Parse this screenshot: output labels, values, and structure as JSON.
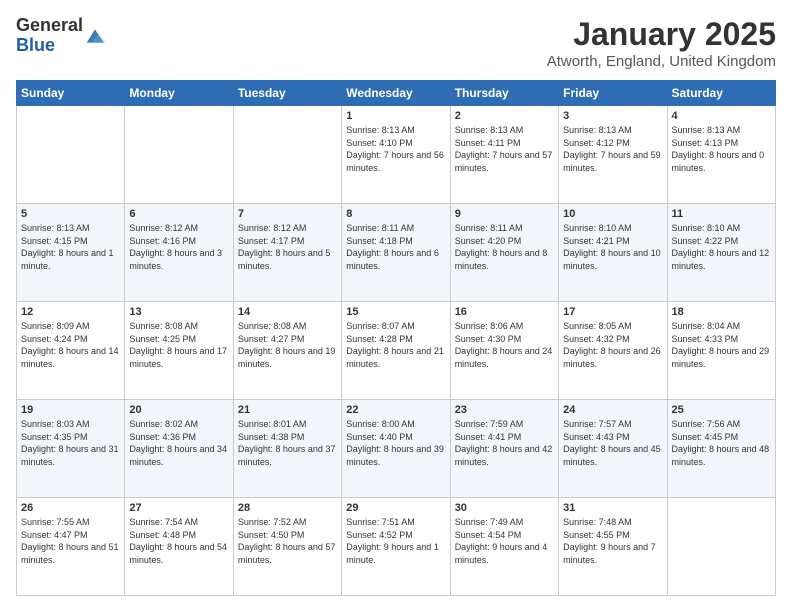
{
  "logo": {
    "general": "General",
    "blue": "Blue"
  },
  "header": {
    "title": "January 2025",
    "subtitle": "Atworth, England, United Kingdom"
  },
  "weekdays": [
    "Sunday",
    "Monday",
    "Tuesday",
    "Wednesday",
    "Thursday",
    "Friday",
    "Saturday"
  ],
  "weeks": [
    [
      {
        "day": "",
        "sunrise": "",
        "sunset": "",
        "daylight": ""
      },
      {
        "day": "",
        "sunrise": "",
        "sunset": "",
        "daylight": ""
      },
      {
        "day": "",
        "sunrise": "",
        "sunset": "",
        "daylight": ""
      },
      {
        "day": "1",
        "sunrise": "Sunrise: 8:13 AM",
        "sunset": "Sunset: 4:10 PM",
        "daylight": "Daylight: 7 hours and 56 minutes."
      },
      {
        "day": "2",
        "sunrise": "Sunrise: 8:13 AM",
        "sunset": "Sunset: 4:11 PM",
        "daylight": "Daylight: 7 hours and 57 minutes."
      },
      {
        "day": "3",
        "sunrise": "Sunrise: 8:13 AM",
        "sunset": "Sunset: 4:12 PM",
        "daylight": "Daylight: 7 hours and 59 minutes."
      },
      {
        "day": "4",
        "sunrise": "Sunrise: 8:13 AM",
        "sunset": "Sunset: 4:13 PM",
        "daylight": "Daylight: 8 hours and 0 minutes."
      }
    ],
    [
      {
        "day": "5",
        "sunrise": "Sunrise: 8:13 AM",
        "sunset": "Sunset: 4:15 PM",
        "daylight": "Daylight: 8 hours and 1 minute."
      },
      {
        "day": "6",
        "sunrise": "Sunrise: 8:12 AM",
        "sunset": "Sunset: 4:16 PM",
        "daylight": "Daylight: 8 hours and 3 minutes."
      },
      {
        "day": "7",
        "sunrise": "Sunrise: 8:12 AM",
        "sunset": "Sunset: 4:17 PM",
        "daylight": "Daylight: 8 hours and 5 minutes."
      },
      {
        "day": "8",
        "sunrise": "Sunrise: 8:11 AM",
        "sunset": "Sunset: 4:18 PM",
        "daylight": "Daylight: 8 hours and 6 minutes."
      },
      {
        "day": "9",
        "sunrise": "Sunrise: 8:11 AM",
        "sunset": "Sunset: 4:20 PM",
        "daylight": "Daylight: 8 hours and 8 minutes."
      },
      {
        "day": "10",
        "sunrise": "Sunrise: 8:10 AM",
        "sunset": "Sunset: 4:21 PM",
        "daylight": "Daylight: 8 hours and 10 minutes."
      },
      {
        "day": "11",
        "sunrise": "Sunrise: 8:10 AM",
        "sunset": "Sunset: 4:22 PM",
        "daylight": "Daylight: 8 hours and 12 minutes."
      }
    ],
    [
      {
        "day": "12",
        "sunrise": "Sunrise: 8:09 AM",
        "sunset": "Sunset: 4:24 PM",
        "daylight": "Daylight: 8 hours and 14 minutes."
      },
      {
        "day": "13",
        "sunrise": "Sunrise: 8:08 AM",
        "sunset": "Sunset: 4:25 PM",
        "daylight": "Daylight: 8 hours and 17 minutes."
      },
      {
        "day": "14",
        "sunrise": "Sunrise: 8:08 AM",
        "sunset": "Sunset: 4:27 PM",
        "daylight": "Daylight: 8 hours and 19 minutes."
      },
      {
        "day": "15",
        "sunrise": "Sunrise: 8:07 AM",
        "sunset": "Sunset: 4:28 PM",
        "daylight": "Daylight: 8 hours and 21 minutes."
      },
      {
        "day": "16",
        "sunrise": "Sunrise: 8:06 AM",
        "sunset": "Sunset: 4:30 PM",
        "daylight": "Daylight: 8 hours and 24 minutes."
      },
      {
        "day": "17",
        "sunrise": "Sunrise: 8:05 AM",
        "sunset": "Sunset: 4:32 PM",
        "daylight": "Daylight: 8 hours and 26 minutes."
      },
      {
        "day": "18",
        "sunrise": "Sunrise: 8:04 AM",
        "sunset": "Sunset: 4:33 PM",
        "daylight": "Daylight: 8 hours and 29 minutes."
      }
    ],
    [
      {
        "day": "19",
        "sunrise": "Sunrise: 8:03 AM",
        "sunset": "Sunset: 4:35 PM",
        "daylight": "Daylight: 8 hours and 31 minutes."
      },
      {
        "day": "20",
        "sunrise": "Sunrise: 8:02 AM",
        "sunset": "Sunset: 4:36 PM",
        "daylight": "Daylight: 8 hours and 34 minutes."
      },
      {
        "day": "21",
        "sunrise": "Sunrise: 8:01 AM",
        "sunset": "Sunset: 4:38 PM",
        "daylight": "Daylight: 8 hours and 37 minutes."
      },
      {
        "day": "22",
        "sunrise": "Sunrise: 8:00 AM",
        "sunset": "Sunset: 4:40 PM",
        "daylight": "Daylight: 8 hours and 39 minutes."
      },
      {
        "day": "23",
        "sunrise": "Sunrise: 7:59 AM",
        "sunset": "Sunset: 4:41 PM",
        "daylight": "Daylight: 8 hours and 42 minutes."
      },
      {
        "day": "24",
        "sunrise": "Sunrise: 7:57 AM",
        "sunset": "Sunset: 4:43 PM",
        "daylight": "Daylight: 8 hours and 45 minutes."
      },
      {
        "day": "25",
        "sunrise": "Sunrise: 7:56 AM",
        "sunset": "Sunset: 4:45 PM",
        "daylight": "Daylight: 8 hours and 48 minutes."
      }
    ],
    [
      {
        "day": "26",
        "sunrise": "Sunrise: 7:55 AM",
        "sunset": "Sunset: 4:47 PM",
        "daylight": "Daylight: 8 hours and 51 minutes."
      },
      {
        "day": "27",
        "sunrise": "Sunrise: 7:54 AM",
        "sunset": "Sunset: 4:48 PM",
        "daylight": "Daylight: 8 hours and 54 minutes."
      },
      {
        "day": "28",
        "sunrise": "Sunrise: 7:52 AM",
        "sunset": "Sunset: 4:50 PM",
        "daylight": "Daylight: 8 hours and 57 minutes."
      },
      {
        "day": "29",
        "sunrise": "Sunrise: 7:51 AM",
        "sunset": "Sunset: 4:52 PM",
        "daylight": "Daylight: 9 hours and 1 minute."
      },
      {
        "day": "30",
        "sunrise": "Sunrise: 7:49 AM",
        "sunset": "Sunset: 4:54 PM",
        "daylight": "Daylight: 9 hours and 4 minutes."
      },
      {
        "day": "31",
        "sunrise": "Sunrise: 7:48 AM",
        "sunset": "Sunset: 4:55 PM",
        "daylight": "Daylight: 9 hours and 7 minutes."
      },
      {
        "day": "",
        "sunrise": "",
        "sunset": "",
        "daylight": ""
      }
    ]
  ]
}
